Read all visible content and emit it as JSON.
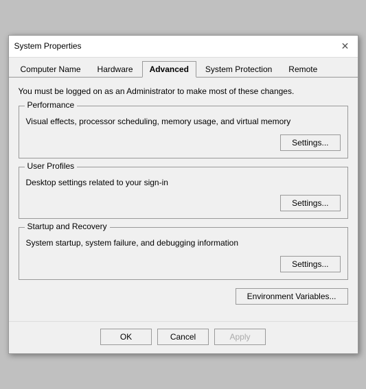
{
  "window": {
    "title": "System Properties",
    "close_label": "✕"
  },
  "tabs": [
    {
      "label": "Computer Name",
      "active": false
    },
    {
      "label": "Hardware",
      "active": false
    },
    {
      "label": "Advanced",
      "active": true
    },
    {
      "label": "System Protection",
      "active": false
    },
    {
      "label": "Remote",
      "active": false
    }
  ],
  "admin_notice": "You must be logged on as an Administrator to make most of these changes.",
  "sections": [
    {
      "legend": "Performance",
      "description": "Visual effects, processor scheduling, memory usage, and virtual memory",
      "settings_label": "Settings..."
    },
    {
      "legend": "User Profiles",
      "description": "Desktop settings related to your sign-in",
      "settings_label": "Settings..."
    },
    {
      "legend": "Startup and Recovery",
      "description": "System startup, system failure, and debugging information",
      "settings_label": "Settings..."
    }
  ],
  "env_variables_label": "Environment Variables...",
  "ok_label": "OK",
  "cancel_label": "Cancel",
  "apply_label": "Apply"
}
